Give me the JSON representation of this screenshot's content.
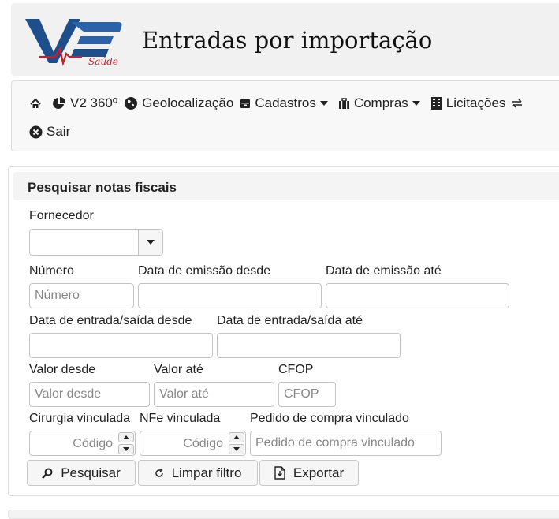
{
  "header": {
    "title": "Entradas por importação",
    "logo_text": "Saúde"
  },
  "nav": {
    "items": [
      {
        "label": "",
        "icon": "home-icon"
      },
      {
        "label": "V2 360º",
        "icon": "pie-chart-icon"
      },
      {
        "label": "Geolocalização",
        "icon": "globe-icon"
      },
      {
        "label": "Cadastros",
        "icon": "archive-icon",
        "dropdown": true
      },
      {
        "label": "Compras",
        "icon": "briefcase-icon",
        "dropdown": true
      },
      {
        "label": "Licitações",
        "icon": "building-icon"
      },
      {
        "label": "",
        "icon": "exchange-icon"
      }
    ],
    "logout_label": "Sair"
  },
  "panel": {
    "title": "Pesquisar notas fiscais",
    "fields": {
      "fornecedor": {
        "label": "Fornecedor",
        "value": ""
      },
      "numero": {
        "label": "Número",
        "placeholder": "Número",
        "value": ""
      },
      "emissao_desde": {
        "label": "Data de emissão desde",
        "value": ""
      },
      "emissao_ate": {
        "label": "Data de emissão até",
        "value": ""
      },
      "entrada_desde": {
        "label": "Data de entrada/saída desde",
        "value": ""
      },
      "entrada_ate": {
        "label": "Data de entrada/saída até",
        "value": ""
      },
      "valor_desde": {
        "label": "Valor desde",
        "placeholder": "Valor desde",
        "value": ""
      },
      "valor_ate": {
        "label": "Valor até",
        "placeholder": "Valor até",
        "value": ""
      },
      "cfop": {
        "label": "CFOP",
        "placeholder": "CFOP",
        "value": ""
      },
      "cirurgia": {
        "label": "Cirurgia vinculada",
        "placeholder": "Código"
      },
      "nfe": {
        "label": "NFe vinculada",
        "placeholder": "Código"
      },
      "pedido": {
        "label": "Pedido de compra vinculado",
        "placeholder": "Pedido de compra vinculado",
        "value": ""
      }
    },
    "buttons": {
      "search": "Pesquisar",
      "clear": "Limpar filtro",
      "export": "Exportar"
    }
  }
}
